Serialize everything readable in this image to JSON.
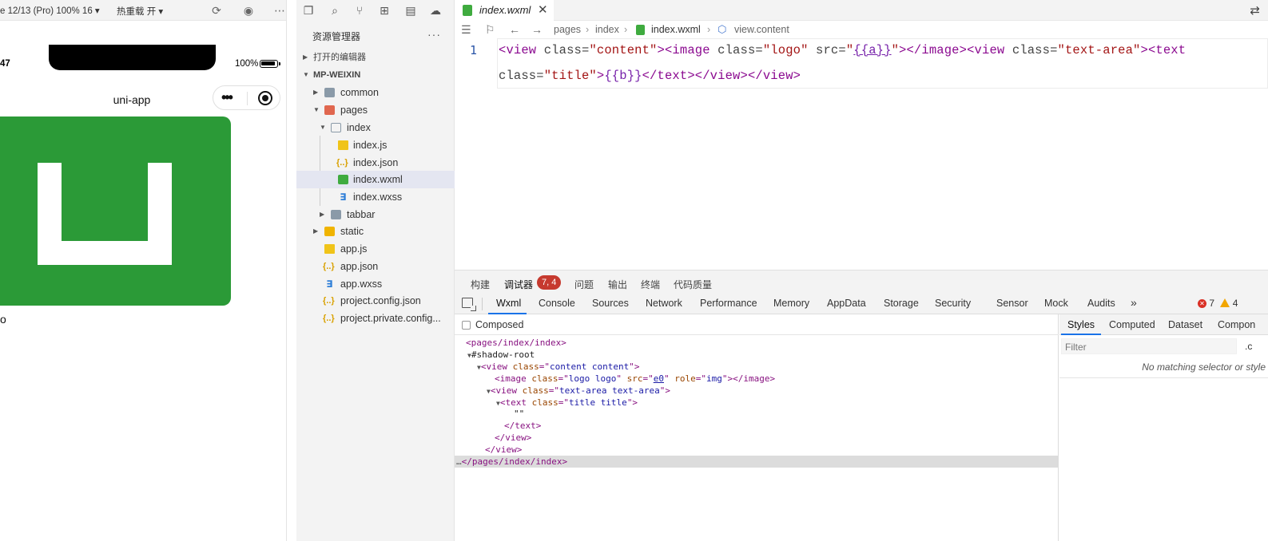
{
  "simulator": {
    "device_label": "e 12/13 (Pro) 100% 16 ▾",
    "hot_reload_label": "热重载 开 ▾",
    "status_time": "47",
    "battery_percent": "100%",
    "nav_title": "uni-app",
    "capsule_dots": "•••",
    "logo_color": "#2b9a37",
    "page_text_partial": "o"
  },
  "explorer": {
    "title": "资源管理器",
    "more": "···",
    "sections": {
      "open_editors": "打开的编辑器",
      "project": "MP-WEIXIN"
    },
    "tree": [
      {
        "name": "common",
        "type": "folder"
      },
      {
        "name": "pages",
        "type": "folder-open"
      },
      {
        "name": "index",
        "type": "folder-open"
      },
      {
        "name": "index.js",
        "type": "js"
      },
      {
        "name": "index.json",
        "type": "json"
      },
      {
        "name": "index.wxml",
        "type": "wxml",
        "selected": true
      },
      {
        "name": "index.wxss",
        "type": "wxss"
      },
      {
        "name": "tabbar",
        "type": "folder"
      },
      {
        "name": "static",
        "type": "folder"
      },
      {
        "name": "app.js",
        "type": "js"
      },
      {
        "name": "app.json",
        "type": "json"
      },
      {
        "name": "app.wxss",
        "type": "wxss"
      },
      {
        "name": "project.config.json",
        "type": "json"
      },
      {
        "name": "project.private.config...",
        "type": "json"
      }
    ]
  },
  "editor": {
    "tab_title": "index.wxml",
    "tab_close": "✕",
    "breadcrumb": [
      "pages",
      "index",
      "index.wxml",
      "view.content"
    ],
    "line_number": "1",
    "code_line1": "<view class=\"content\"><image class=\"logo\" src=\"{{a}}\"></image><view class=\"text-area\"><text",
    "code_line2": "class=\"title\">{{b}}</text></view></view>"
  },
  "devtools": {
    "top_tabs": [
      "构建",
      "调试器",
      "问题",
      "输出",
      "终端",
      "代码质量"
    ],
    "debugger_badge": "7, 4",
    "tabs": [
      "Wxml",
      "Console",
      "Sources",
      "Network",
      "Performance",
      "Memory",
      "AppData",
      "Storage",
      "Security",
      "Sensor",
      "Mock",
      "Audits"
    ],
    "more_tabs": "»",
    "error_count": "7",
    "warning_count": "4",
    "composed_label": "Composed",
    "dom": {
      "line1": "<pages/index/index>",
      "shadow_root": "#shadow-root",
      "view_class": "content content",
      "image_class": "logo logo",
      "image_src": "e0",
      "image_role": "img",
      "text_area_class": "text-area text-area",
      "text_class": "title title",
      "text_content": "\"\"",
      "close_line": "</pages/index/index>"
    },
    "styles": {
      "tabs": [
        "Styles",
        "Computed",
        "Dataset",
        "Compon"
      ],
      "filter_placeholder": "Filter",
      "filter_cls": ".c",
      "no_match": "No matching selector or style"
    }
  }
}
